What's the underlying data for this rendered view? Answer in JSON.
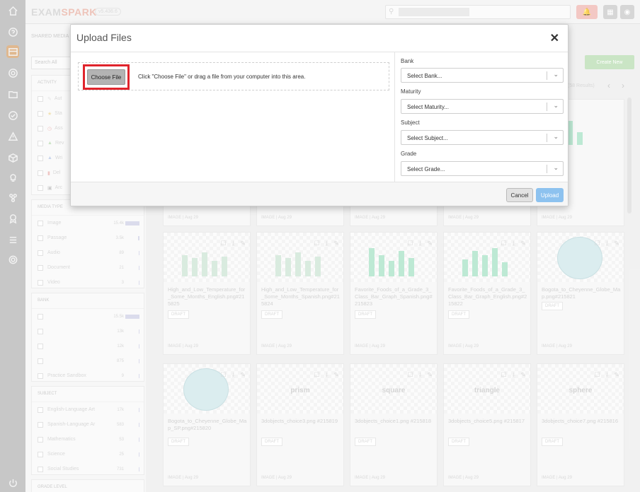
{
  "topbar": {
    "logo_part1": "EXAM",
    "logo_part2": "SPARK",
    "version": "v5.436.6"
  },
  "left_panel": {
    "title": "SHARED MEDIA",
    "search_placeholder": "Search All",
    "activity": {
      "header": "ACTIVITY",
      "items": [
        "Aut",
        "Sta",
        "Ass",
        "Rev",
        "Wri",
        "Del",
        "Arc"
      ]
    },
    "media_type": {
      "header": "MEDIA TYPE",
      "items": [
        {
          "label": "Image",
          "count": "15.4k"
        },
        {
          "label": "Passage",
          "count": "3.5k"
        },
        {
          "label": "Audio",
          "count": "89"
        },
        {
          "label": "Document",
          "count": "21"
        },
        {
          "label": "Video",
          "count": "3"
        }
      ]
    },
    "bank": {
      "header": "BANK",
      "items": [
        {
          "label": "",
          "count": "15.5k"
        },
        {
          "label": "",
          "count": "13k"
        },
        {
          "label": "",
          "count": "12k"
        },
        {
          "label": "",
          "count": "875"
        },
        {
          "label": "Practice Sandbox",
          "count": "9"
        }
      ]
    },
    "subject": {
      "header": "SUBJECT",
      "items": [
        {
          "label": "English-Language Art",
          "count": "17k"
        },
        {
          "label": "Spanish-Language Ar",
          "count": "583"
        },
        {
          "label": "Mathematics",
          "count": "53"
        },
        {
          "label": "Science",
          "count": "25"
        },
        {
          "label": "Social Studies",
          "count": "731"
        }
      ]
    },
    "grade_level": {
      "header": "GRADE LEVEL"
    }
  },
  "main": {
    "create_new": "Create New",
    "results": "(58 Results)",
    "row1_meta": [
      "IMAGE | Aug 29",
      "IMAGE | Aug 29",
      "IMAGE | Aug 29",
      "IMAGE | Aug 29",
      "IMAGE | Aug 29"
    ],
    "cards_row2": [
      {
        "title": "High_and_Low_Temperature_for_Some_Months_English.png#215825",
        "status": "DRAFT",
        "meta": "IMAGE | Aug 29"
      },
      {
        "title": "High_and_Low_Temperature_for_Some_Months_Spanish.png#215824",
        "status": "DRAFT",
        "meta": "IMAGE | Aug 29"
      },
      {
        "title": "Favorite_Foods_of_a_Grade_3_Class_Bar_Graph_Spanish.png#215823",
        "status": "DRAFT",
        "meta": "IMAGE | Aug 29"
      },
      {
        "title": "Favorite_Foods_of_a_Grade_3_Class_Bar_Graph_English.png#215822",
        "status": "DRAFT",
        "meta": "IMAGE | Aug 29"
      },
      {
        "title": "Bogota_to_Cheyenne_Globe_Map.png#215821",
        "status": "DRAFT",
        "meta": "IMAGE | Aug 29"
      }
    ],
    "cards_row3": [
      {
        "title": "Bogota_to_Cheyenne_Globe_Map_SP.png#215820",
        "status": "DRAFT",
        "meta": "IMAGE | Aug 29",
        "word": ""
      },
      {
        "title": "3dobjects_choice3.png #215819",
        "status": "DRAFT",
        "meta": "IMAGE | Aug 29",
        "word": "prism"
      },
      {
        "title": "3dobjects_choice1.png #215818",
        "status": "DRAFT",
        "meta": "IMAGE | Aug 29",
        "word": "square"
      },
      {
        "title": "3dobjects_choice5.png #215817",
        "status": "DRAFT",
        "meta": "IMAGE | Aug 29",
        "word": "triangle"
      },
      {
        "title": "3dobjects_choice7.png #215816",
        "status": "DRAFT",
        "meta": "IMAGE | Aug 29",
        "word": "sphere"
      }
    ]
  },
  "modal": {
    "title": "Upload Files",
    "close": "✕",
    "choose_file": "Choose File",
    "drop_hint": "Click \"Choose File\" or drag a file from your computer into this area.",
    "fields": [
      {
        "label": "Bank",
        "placeholder": "Select Bank..."
      },
      {
        "label": "Maturity",
        "placeholder": "Select Maturity..."
      },
      {
        "label": "Subject",
        "placeholder": "Select Subject..."
      },
      {
        "label": "Grade",
        "placeholder": "Select Grade..."
      }
    ],
    "cancel": "Cancel",
    "upload": "Upload"
  },
  "colors": {
    "highlight": "#e0242c",
    "upload_button": "#8dc2ef",
    "create_new": "#b9ddb2",
    "rail_active": "#d6a06a"
  }
}
